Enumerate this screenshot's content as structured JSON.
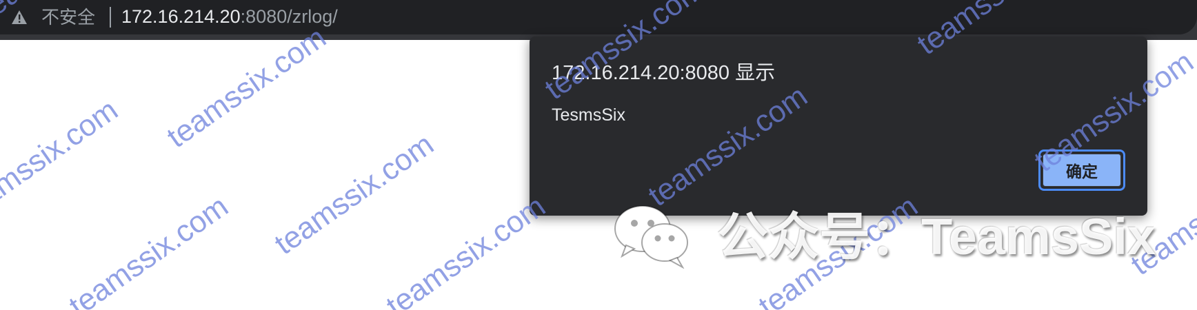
{
  "browser": {
    "security_label": "不安全",
    "url_host": "172.16.214.20",
    "url_rest": ":8080/zrlog/"
  },
  "dialog": {
    "title": "172.16.214.20:8080 显示",
    "message": "TesmsSix",
    "ok_label": "确定"
  },
  "watermark": {
    "tiled_text": "teamssix.com",
    "wechat_text": "公众号：TeamsSix"
  },
  "colors": {
    "toolbar": "#202124",
    "dialog_bg": "#292a2d",
    "button": "#8ab4f8",
    "watermark": "#6e82dc"
  }
}
